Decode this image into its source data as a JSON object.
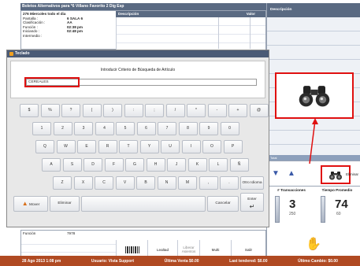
{
  "topbar": {
    "title": "Boletos Alternativos para  *6 Villano Favorito 2 Dig Esp"
  },
  "info": {
    "title": "276 Miercoles todo el dia",
    "rows": [
      {
        "k": "Pantalla :",
        "v": "6  SALA 6"
      },
      {
        "k": "Clasificación :",
        "v": "AA"
      },
      {
        "k": "Función :",
        "v": "02:38 pm"
      },
      {
        "k": "Iniciando :",
        "v": "02:48 pm"
      },
      {
        "k": "Intermedio :",
        "v": ""
      }
    ]
  },
  "desc_table": {
    "col_desc": "Descripción",
    "col_valor": "Valor"
  },
  "right_panel": {
    "header": "Descripción",
    "total_label": "Total"
  },
  "nav": {
    "up_icon": "▲",
    "down_icon": "▼",
    "eliminar": "Eliminar"
  },
  "stats": {
    "trans_label": "# Transacciones",
    "trans_value": "3",
    "trans_sub": "250",
    "tiempo_label": "Tiempo Promedio",
    "tiempo_value": "74",
    "tiempo_sub": "60"
  },
  "bottom": {
    "funcion_label": "Función",
    "funcion_value": "7978",
    "btn_lealtad": "Lealtad",
    "btn_liberar": "Liberar Asientos",
    "btn_multi": "Multi",
    "btn_salir": "Salir"
  },
  "status_bar": {
    "date": "28 Ago 2013 1:08 pm",
    "user": "Usuario: Vista Support",
    "last_sale": "Última Venta $0.00",
    "last_tendered": "Last tendered: $0.00",
    "last_change": "Último Cambio: $0.00"
  },
  "dialog": {
    "title": "Teclado",
    "prompt": "Introducir Criterio de Búsqueda de Artículo",
    "input_value": "CEREALES",
    "keys_row1": [
      "$",
      "%",
      "?",
      "(",
      ")",
      ":",
      ";",
      "/",
      "*",
      "-",
      "+",
      "@"
    ],
    "keys_row2": [
      "1",
      "2",
      "3",
      "4",
      "5",
      "6",
      "7",
      "8",
      "9",
      "0"
    ],
    "keys_row3": [
      "Q",
      "W",
      "E",
      "R",
      "T",
      "Y",
      "U",
      "I",
      "O",
      "P"
    ],
    "keys_row4": [
      "A",
      "S",
      "D",
      "F",
      "G",
      "H",
      "J",
      "K",
      "L",
      "Ñ"
    ],
    "keys_row5": [
      "Z",
      "X",
      "C",
      "V",
      "B",
      "N",
      "M",
      ",",
      "."
    ],
    "otro_idioma": "Otro Idioma",
    "mover": "Mover",
    "eliminar": "Eliminar",
    "cancelar": "Cancelar",
    "enter": "Enter"
  },
  "colors": {
    "accent_red": "#e01010",
    "header_blue": "#5a6a82",
    "status_orange": "#b04a22"
  },
  "icons": {
    "binoculars": "binoculars-icon",
    "hand": "hand-icon"
  }
}
